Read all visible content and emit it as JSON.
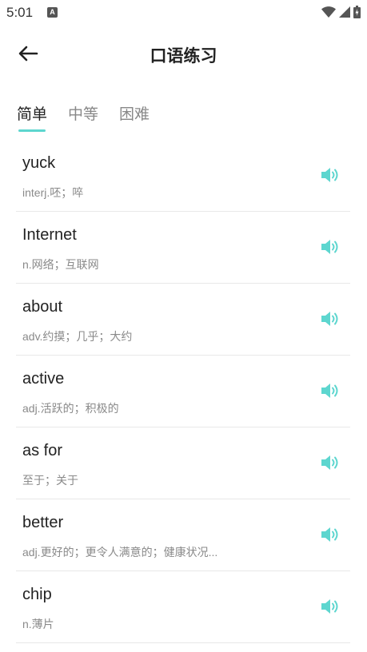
{
  "status_bar": {
    "time": "5:01",
    "notification_icon_letter": "A"
  },
  "header": {
    "title": "口语练习",
    "back_icon": "arrow-left-icon"
  },
  "tabs": [
    {
      "label": "简单",
      "active": true
    },
    {
      "label": "中等",
      "active": false
    },
    {
      "label": "困难",
      "active": false
    }
  ],
  "words": [
    {
      "word": "yuck",
      "meaning": "interj.呸；啐"
    },
    {
      "word": "Internet",
      "meaning": "n.网络；互联网"
    },
    {
      "word": "about",
      "meaning": "adv.约摸；几乎；大约"
    },
    {
      "word": "active",
      "meaning": "adj.活跃的；积极的"
    },
    {
      "word": "as for",
      "meaning": "至于；关于"
    },
    {
      "word": "better",
      "meaning": "adj.更好的；更令人满意的；健康状况..."
    },
    {
      "word": "chip",
      "meaning": "n.薄片"
    }
  ],
  "colors": {
    "accent": "#5dd6cf",
    "divider": "#e8e8e8"
  }
}
